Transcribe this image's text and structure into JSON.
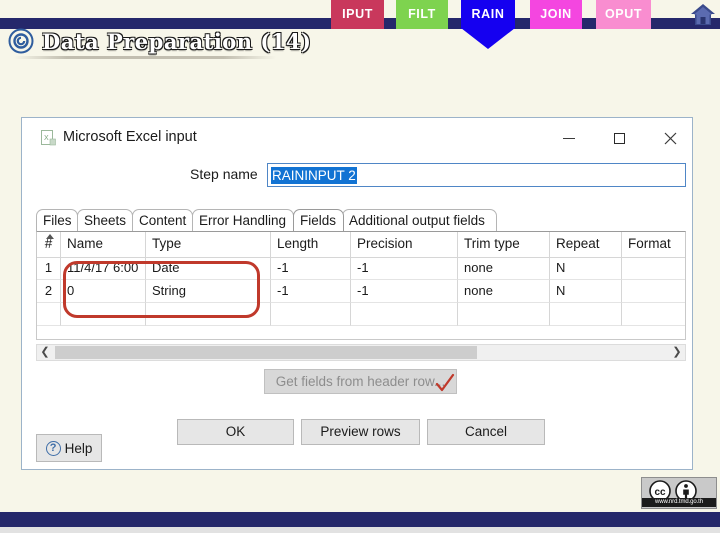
{
  "slide": {
    "title": "Data Preparation (14)",
    "title_icon": "spiral-icon",
    "accent_navy": "#25286b",
    "background": "#f7f6e9"
  },
  "nav": {
    "home_icon": "home-icon",
    "pills": [
      {
        "label": "IPUT",
        "color": "#c9385c",
        "shape": "rect"
      },
      {
        "label": "FILT",
        "color": "#7ed34f",
        "shape": "rect"
      },
      {
        "label": "RAIN",
        "color": "#1500f0",
        "shape": "pennant",
        "active": true
      },
      {
        "label": "JOIN",
        "color": "#f446e0",
        "shape": "rect"
      },
      {
        "label": "OPUT",
        "color": "#f98dd0",
        "shape": "rect"
      }
    ]
  },
  "dialog": {
    "title": "Microsoft Excel input",
    "app_icon": "excel-icon",
    "window_buttons": {
      "minimize": "minimize-icon",
      "maximize": "maximize-icon",
      "close": "close-icon"
    },
    "step_name": {
      "label": "Step name",
      "value": "RAININPUT 2",
      "selected": true
    },
    "tabs": [
      {
        "label": "Files",
        "active": false
      },
      {
        "label": "Sheets",
        "active": false
      },
      {
        "label": "Content",
        "active": false
      },
      {
        "label": "Error Handling",
        "active": false
      },
      {
        "label": "Fields",
        "active": true
      },
      {
        "label": "Additional output fields",
        "active": false
      }
    ],
    "fields_table": {
      "columns": [
        "#",
        "Name",
        "Type",
        "Length",
        "Precision",
        "Trim type",
        "Repeat",
        "Format"
      ],
      "rows": [
        {
          "index": "1",
          "name": "11/4/17 6:00",
          "type": "Date",
          "length": "-1",
          "precision": "-1",
          "trim_type": "none",
          "repeat": "N",
          "format": ""
        },
        {
          "index": "2",
          "name": "0",
          "type": "String",
          "length": "-1",
          "precision": "-1",
          "trim_type": "none",
          "repeat": "N",
          "format": ""
        }
      ]
    },
    "scrollbar": {
      "left_arrow": "chevron-left-icon",
      "right_arrow": "chevron-right-icon"
    },
    "get_fields_label": "Get fields from header row...",
    "buttons": {
      "help": "Help",
      "ok": "OK",
      "preview": "Preview rows",
      "cancel": "Cancel"
    }
  },
  "annotations": {
    "color": "#c0392b",
    "box_target": "name-and-type-columns",
    "check_tab": "fields-tab",
    "check_button": "get-fields-button"
  },
  "credit": {
    "license": "CC BY",
    "url": "www.nrd.tmd.go.th"
  }
}
